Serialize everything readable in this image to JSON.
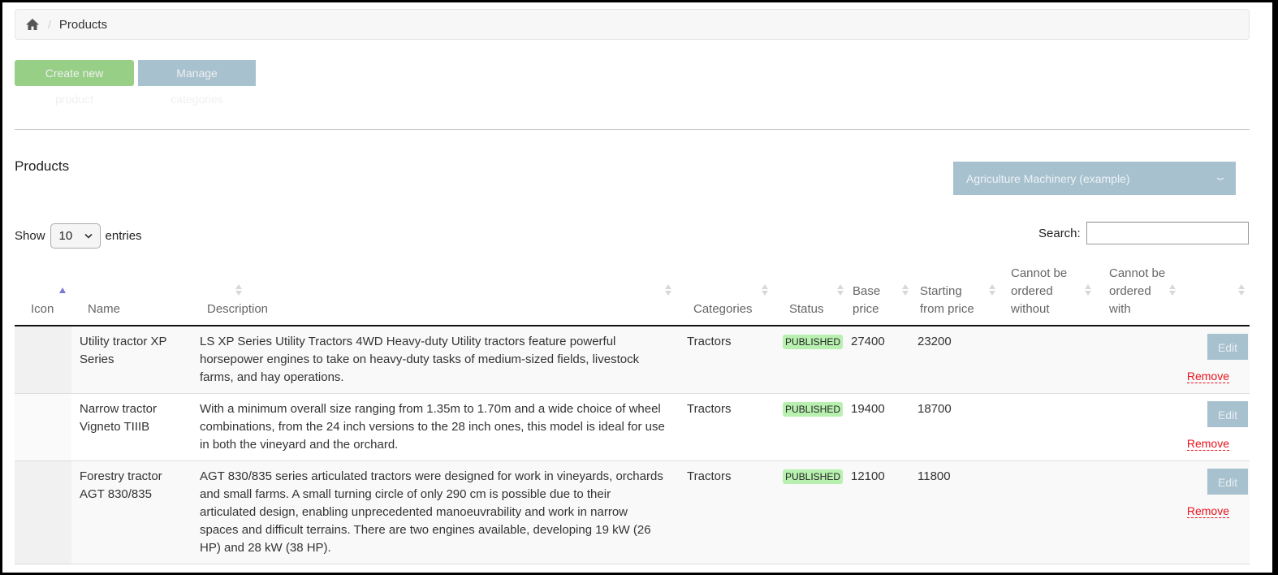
{
  "breadcrumb": {
    "home_icon": "home-icon",
    "separator": "/",
    "current": "Products"
  },
  "toolbar": {
    "create_label": "Create new product",
    "manage_label": "Manage categories"
  },
  "section": {
    "title": "Products",
    "category_select": {
      "selected": "Agriculture Machinery (example)",
      "icon": "chevron-down-icon"
    }
  },
  "table_controls": {
    "show_label": "Show",
    "page_length": "10",
    "entries_label": "entries",
    "search_label": "Search:",
    "search_value": "",
    "search_placeholder": ""
  },
  "table": {
    "columns": [
      {
        "key": "icon",
        "label": "Icon",
        "sort": "asc"
      },
      {
        "key": "name",
        "label": "Name",
        "sort": "none"
      },
      {
        "key": "description",
        "label": "Description",
        "sort": "none"
      },
      {
        "key": "categories",
        "label": "Categories",
        "sort": "none"
      },
      {
        "key": "status",
        "label": "Status",
        "sort": "none"
      },
      {
        "key": "base_price",
        "label": "Base price",
        "sort": "none"
      },
      {
        "key": "starting_price",
        "label": "Starting from price",
        "sort": "none"
      },
      {
        "key": "cannot_without",
        "label": "Cannot be ordered without",
        "sort": "none"
      },
      {
        "key": "cannot_with",
        "label": "Cannot be ordered with",
        "sort": "none"
      },
      {
        "key": "actions",
        "label": "",
        "sort": "none"
      }
    ],
    "rows": [
      {
        "name": "Utility tractor XP Series",
        "description": "LS XP Series Utility Tractors 4WD Heavy-duty Utility tractors feature powerful horsepower engines to take on heavy-duty tasks of medium-sized fields, livestock farms, and hay operations.",
        "categories": "Tractors",
        "status": "PUBLISHED",
        "base_price": "27400",
        "starting_price": "23200",
        "cannot_without": "",
        "cannot_with": "",
        "edit_label": "Edit",
        "remove_label": "Remove"
      },
      {
        "name": "Narrow tractor Vigneto TIIIB",
        "description": "With a minimum overall size ranging from 1.35m to 1.70m and a wide choice of wheel combinations, from the 24 inch versions to the 28 inch ones, this model is ideal for use in both the vineyard and the orchard.",
        "categories": "Tractors",
        "status": "PUBLISHED",
        "base_price": "19400",
        "starting_price": "18700",
        "cannot_without": "",
        "cannot_with": "",
        "edit_label": "Edit",
        "remove_label": "Remove"
      },
      {
        "name": "Forestry tractor AGT 830/835",
        "description": "AGT 830/835 series articulated tractors were designed for work in vineyards, orchards and small farms. A small turning circle of only 290 cm is possible due to their articulated design, enabling unprecedented manoeuvrability and work in narrow spaces and difficult terrains. There are two engines available, developing 19 kW (26 HP) and 28 kW (38 HP).",
        "categories": "Tractors",
        "status": "PUBLISHED",
        "base_price": "12100",
        "starting_price": "11800",
        "cannot_without": "",
        "cannot_with": "",
        "edit_label": "Edit",
        "remove_label": "Remove"
      }
    ]
  },
  "colors": {
    "create_button": "#97cf87",
    "manage_button": "#a7c1cf",
    "published_badge": "#b8f0b0",
    "remove_link": "#e8121b",
    "sort_active": "#7b7bd6"
  }
}
